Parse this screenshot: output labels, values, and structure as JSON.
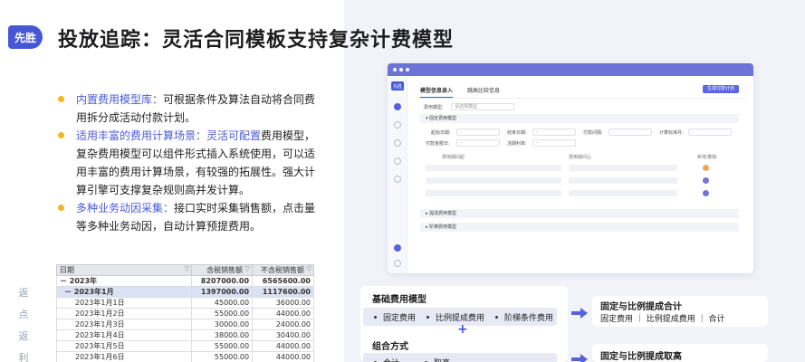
{
  "brand": {
    "badge": "先胜"
  },
  "page": {
    "title": "投放追踪：灵活合同模板支持复杂计费模型"
  },
  "bullets": [
    {
      "highlight": "内置费用模型库：",
      "rest": "可根据条件及算法自动将合同费用拆分成活动付款计划。"
    },
    {
      "highlight": "适用丰富的费用计算场景：灵活可配置",
      "rest": "费用模型，复杂费用模型可以组件形式插入系统使用，可以适用丰富的费用计算场景，有较强的拓展性。强大计算引擎可支撑复杂规则高并发计算。"
    },
    {
      "highlight": "多种业务动因采集：",
      "rest": "接口实时采集销售额，点击量等多种业务动因，自动计算预提费用。"
    }
  ],
  "side_text": [
    "返",
    "点",
    "返",
    "利"
  ],
  "table": {
    "headers": [
      "日期",
      "含税销售额",
      "不含税销售额"
    ],
    "rows": [
      {
        "date": "－ 2023年",
        "a": "8207000.00",
        "b": "6565600.00",
        "level": "year"
      },
      {
        "date": "－ 2023年1月",
        "a": "1397000.00",
        "b": "1117600.00",
        "level": "month"
      },
      {
        "date": "2023年1月1日",
        "a": "45000.00",
        "b": "36000.00",
        "level": "day"
      },
      {
        "date": "2023年1月2日",
        "a": "55000.00",
        "b": "44000.00",
        "level": "day"
      },
      {
        "date": "2023年1月3日",
        "a": "30000.00",
        "b": "24000.00",
        "level": "day"
      },
      {
        "date": "2023年1月4日",
        "a": "38000.00",
        "b": "30400.00",
        "level": "day"
      },
      {
        "date": "2023年1月5日",
        "a": "55000.00",
        "b": "44000.00",
        "level": "day"
      },
      {
        "date": "2023年1月6日",
        "a": "55000.00",
        "b": "44000.00",
        "level": "day"
      }
    ]
  },
  "app": {
    "logo": "先胜",
    "tabs": [
      "模型信息录入",
      "跳高比较信息"
    ],
    "action_button": "生成付款计划",
    "field_model_label": "费用模型:",
    "field_model_placeholder": "请选择模型",
    "section1": "固定费用模型",
    "row1": [
      {
        "label": "起始日期:",
        "value": "-"
      },
      {
        "label": "结束日期:",
        "value": "-"
      },
      {
        "label": "付款间隔:",
        "value": "-"
      },
      {
        "label": "计算标准月:",
        "value": "-"
      }
    ],
    "row2": [
      {
        "label": "付款金额日:",
        "value": "-"
      },
      {
        "label": "活期利率:",
        "value": "-"
      }
    ],
    "grid_headers": [
      "费用期间起",
      "费用期间止",
      "新增/删除"
    ],
    "section2": "提成费用模型",
    "section3": "阶梯费用模型"
  },
  "flow": {
    "basic_title": "基础费用模型",
    "basic_items": [
      "固定费用",
      "比例提成费用",
      "阶梯条件费用"
    ],
    "plus": "+",
    "combo_title": "组合方式",
    "combo_items": [
      "合计",
      "取高"
    ],
    "result1_title": "固定与比例提成合计",
    "result1_sub": "固定费用 ｜ 比例提成费用 ｜ 合计",
    "result2_title": "固定与比例提成取高"
  },
  "colors": {
    "accent": "#4657d6",
    "bullet": "#f2b523",
    "window_bar": "#6b72d8"
  }
}
